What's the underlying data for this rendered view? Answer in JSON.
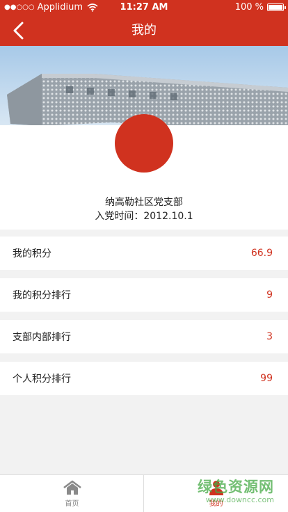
{
  "status_bar": {
    "dots": "●●○○○",
    "carrier": "Applidium",
    "time": "11:27 AM",
    "battery": "100 %"
  },
  "nav": {
    "title": "我的"
  },
  "profile": {
    "org_name": "纳高勒社区党支部",
    "join_date": "入党时间：2012.10.1"
  },
  "list": {
    "items": [
      {
        "label": "我的积分",
        "value": "66.9"
      },
      {
        "label": "我的积分排行",
        "value": "9"
      },
      {
        "label": "支部内部排行",
        "value": "3"
      },
      {
        "label": "个人积分排行",
        "value": "99"
      }
    ]
  },
  "tabs": [
    {
      "label": "首页",
      "icon": "home-icon"
    },
    {
      "label": "我的",
      "icon": "person-icon"
    }
  ],
  "watermark": {
    "main": "绿色资源网",
    "sub": "www.downcc.com"
  },
  "colors": {
    "accent": "#d0321f",
    "background": "#f2f2f2"
  }
}
